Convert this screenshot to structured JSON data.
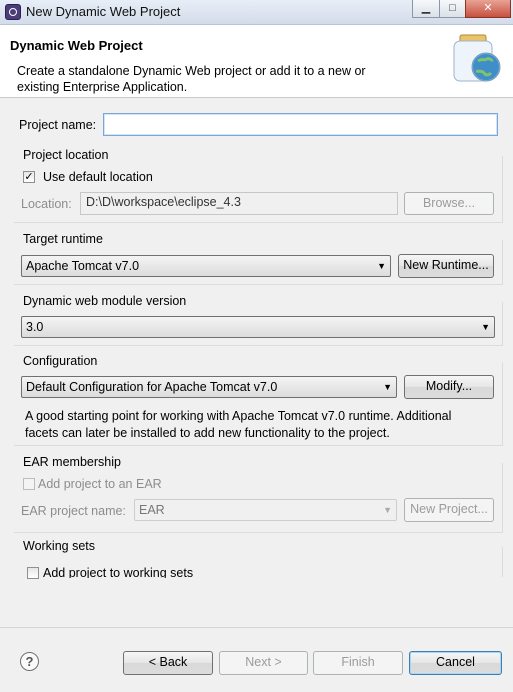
{
  "window": {
    "title": "New Dynamic Web Project",
    "minimize_glyph": "▁",
    "maximize_glyph": "□",
    "close_glyph": "✕"
  },
  "header": {
    "title": "Dynamic Web Project",
    "description_line1": "Create a standalone Dynamic Web project or add it to a new or",
    "description_line2": "existing Enterprise Application."
  },
  "project_name": {
    "label": "Project name:",
    "value": ""
  },
  "project_location": {
    "group_label": "Project location",
    "use_default_checked": true,
    "use_default_label": "Use default location",
    "location_label": "Location:",
    "location_value": "D:\\D\\workspace\\eclipse_4.3",
    "browse_label": "Browse..."
  },
  "target_runtime": {
    "group_label": "Target runtime",
    "selected": "Apache Tomcat v7.0",
    "new_runtime_label": "New Runtime..."
  },
  "module_version": {
    "group_label": "Dynamic web module version",
    "selected": "3.0"
  },
  "configuration": {
    "group_label": "Configuration",
    "selected": "Default Configuration for Apache Tomcat v7.0",
    "modify_label": "Modify...",
    "description_line1": "A good starting point for working with Apache Tomcat v7.0 runtime. Additional",
    "description_line2": "facets can later be installed to add new functionality to the project."
  },
  "ear": {
    "group_label": "EAR membership",
    "add_checked": false,
    "add_label": "Add project to an EAR",
    "project_name_label": "EAR project name:",
    "project_name_value": "EAR",
    "new_project_label": "New Project..."
  },
  "working_sets": {
    "group_label": "Working sets",
    "add_checked": false,
    "add_label": "Add project to working sets"
  },
  "footer": {
    "help_glyph": "?",
    "back_label": "< Back",
    "next_label": "Next >",
    "finish_label": "Finish",
    "cancel_label": "Cancel"
  },
  "icons": [
    "app-icon",
    "web-project-wizard-icon",
    "help-icon",
    "dropdown-arrow-icon",
    "checkmark-icon"
  ],
  "colors": {
    "focus_border": "#7aa7d8",
    "default_button_border": "#3c7fb1",
    "disabled_text": "#8d8d8d"
  }
}
